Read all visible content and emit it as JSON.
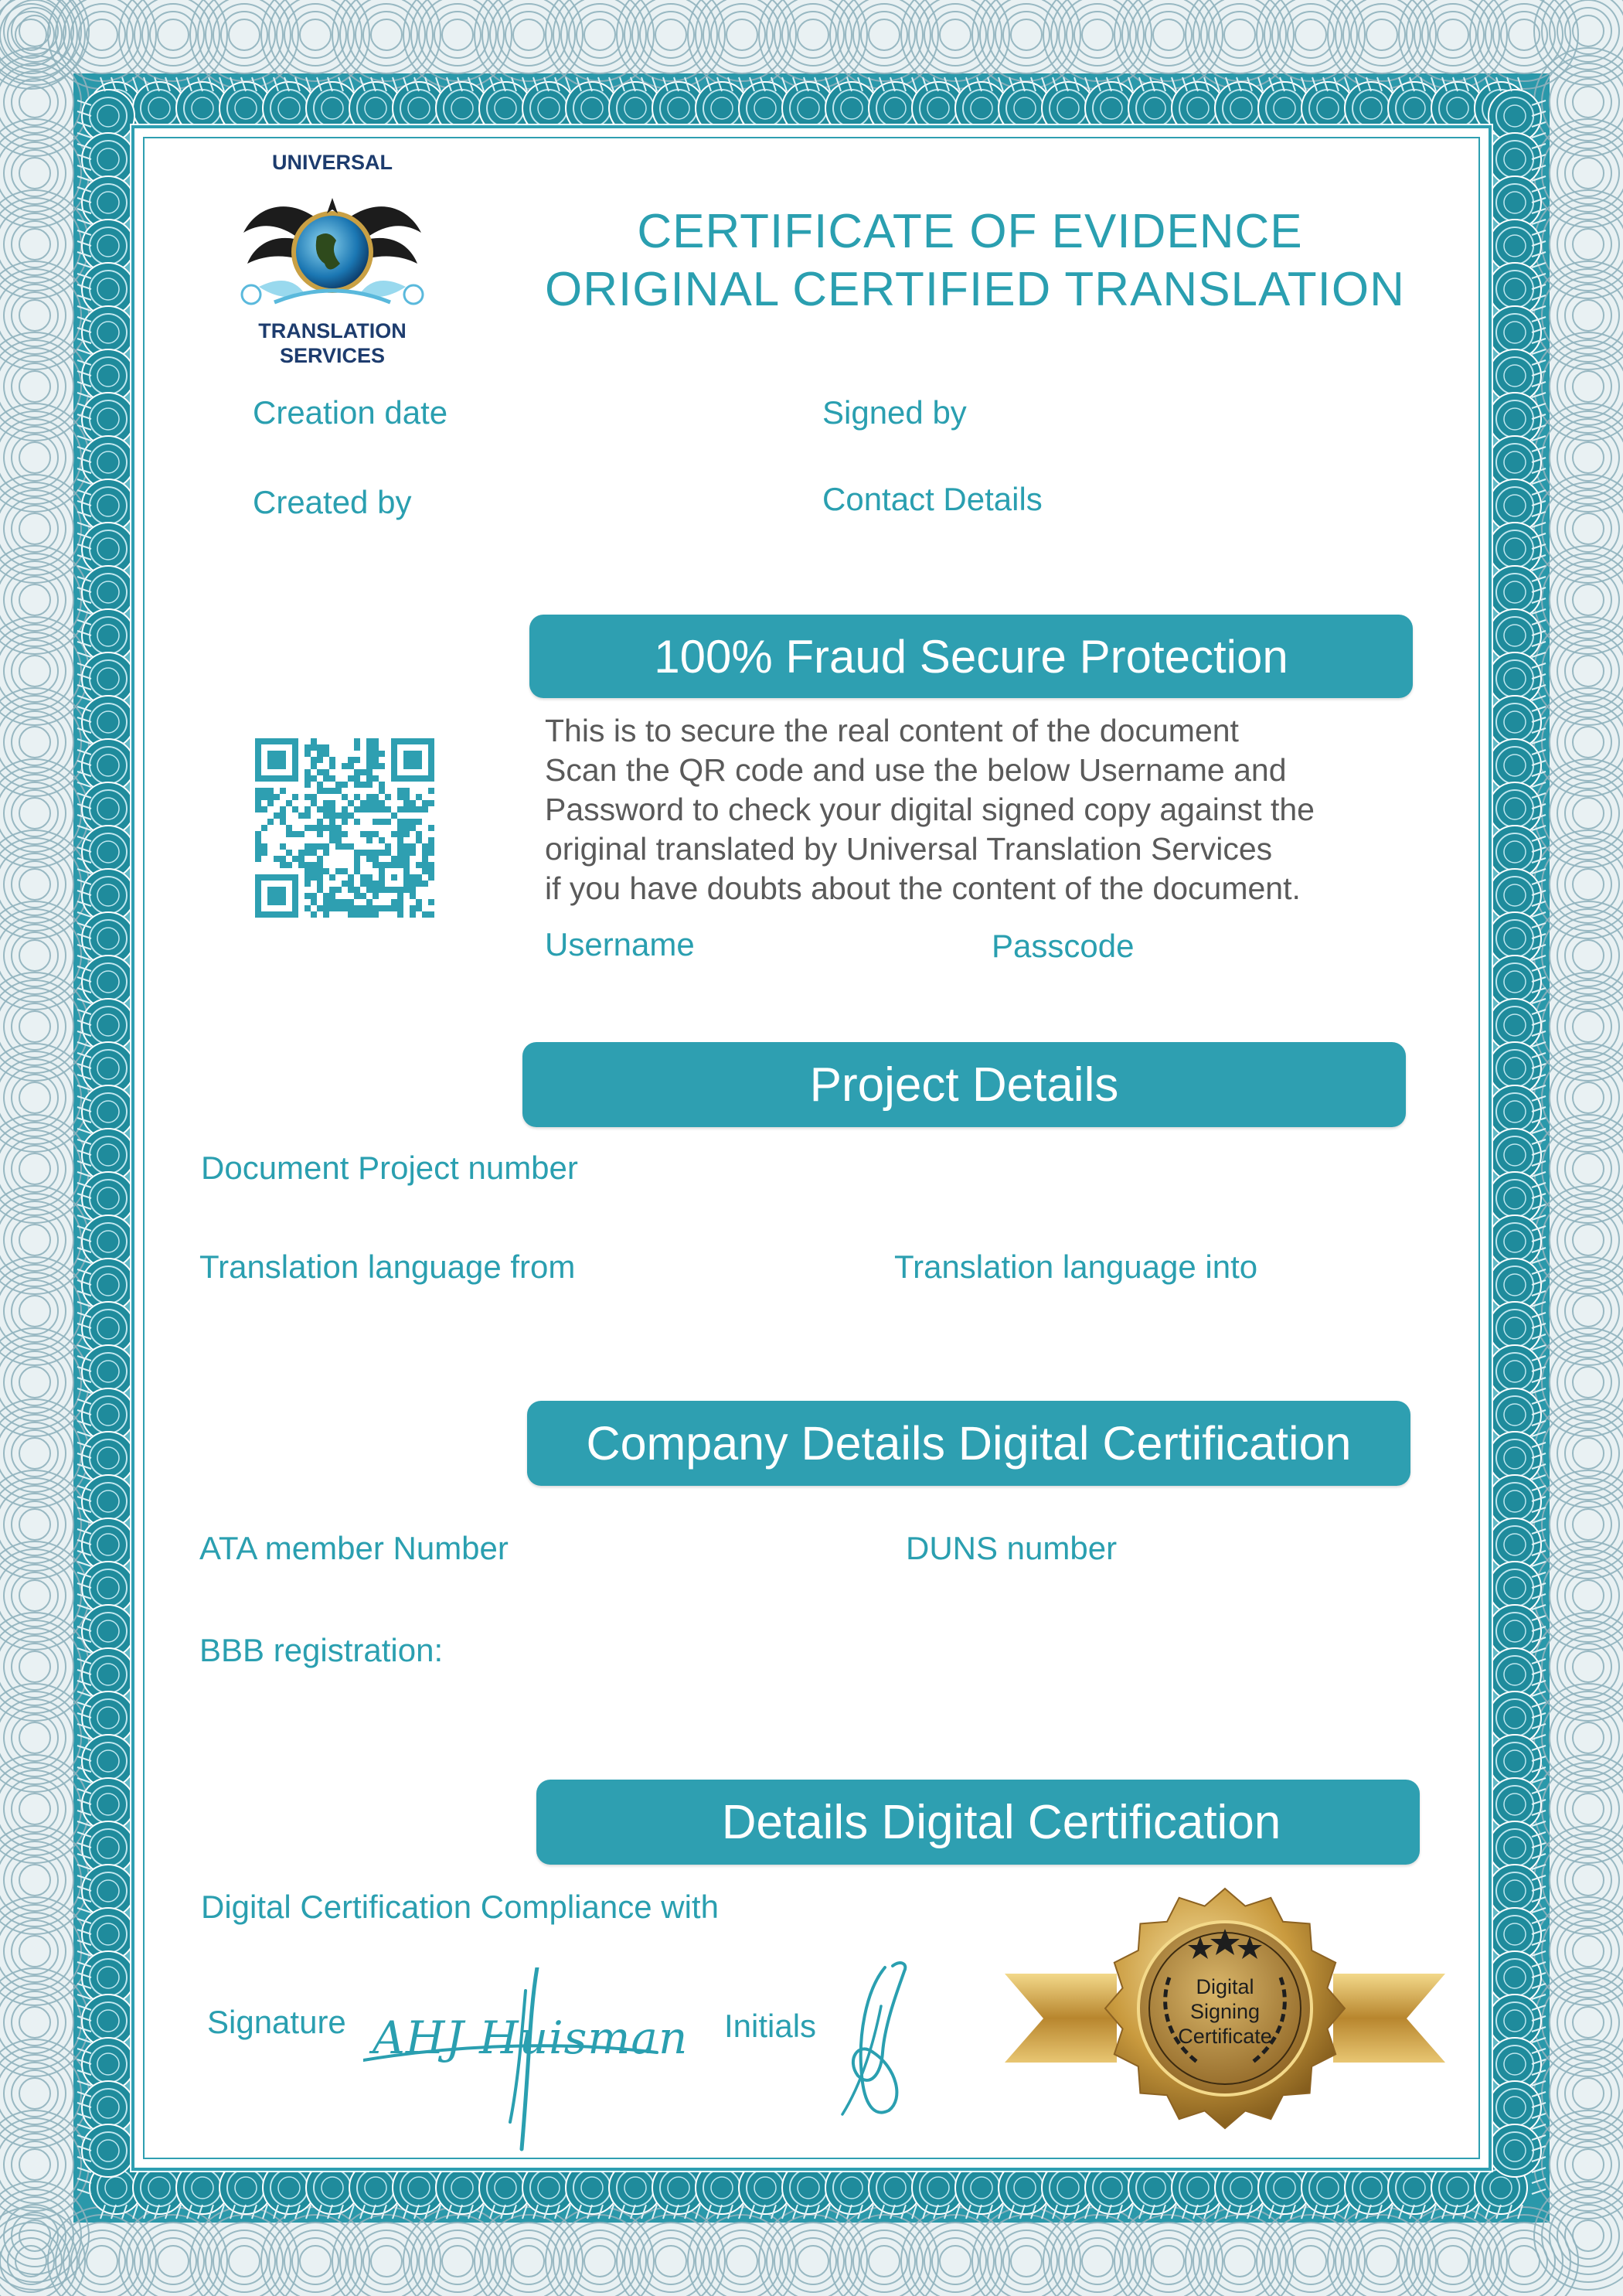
{
  "colors": {
    "accent": "#2e9fb1",
    "label_text": "#2a9fb0",
    "body_text": "#5a5a5a",
    "frame_dark": "#1f8b9c",
    "guilloche": "#8fb1bd",
    "gold": "#c9a044"
  },
  "logo": {
    "line1": "UNIVERSAL",
    "line2": "TRANSLATION",
    "line3": "SERVICES",
    "icon": "globe-eagle-emblem-icon"
  },
  "title": {
    "line1": "CERTIFICATE OF EVIDENCE",
    "line2": "ORIGINAL CERTIFIED TRANSLATION"
  },
  "header_fields": {
    "creation_date": "Creation date",
    "created_by": "Created by",
    "signed_by": "Signed by",
    "contact_details": "Contact Details"
  },
  "fraud": {
    "banner": "100% Fraud Secure Protection",
    "qr_icon": "qr-code-icon",
    "lines": [
      "This is to secure the real content of the document",
      "Scan the QR code and use the below Username and",
      "Password to check your digital signed copy against the",
      "original translated by Universal Translation Services",
      "if you have doubts about the content of the document."
    ],
    "username_label": "Username",
    "passcode_label": "Passcode"
  },
  "project": {
    "banner": "Project Details",
    "document_project_number": "Document Project number",
    "language_from": "Translation language from",
    "language_into": "Translation language into"
  },
  "company": {
    "banner": "Company Details Digital Certification",
    "ata_member": "ATA member Number",
    "duns": "DUNS number",
    "bbb": "BBB registration:"
  },
  "certification": {
    "banner": "Details Digital Certification",
    "compliance": "Digital Certification Compliance with",
    "signature_label": "Signature",
    "signature_text": "AHJ Huisman",
    "initials_label": "Initials",
    "seal": {
      "line1": "Digital",
      "line2": "Signing",
      "line3": "Certificate",
      "icon": "gold-seal-icon"
    }
  }
}
